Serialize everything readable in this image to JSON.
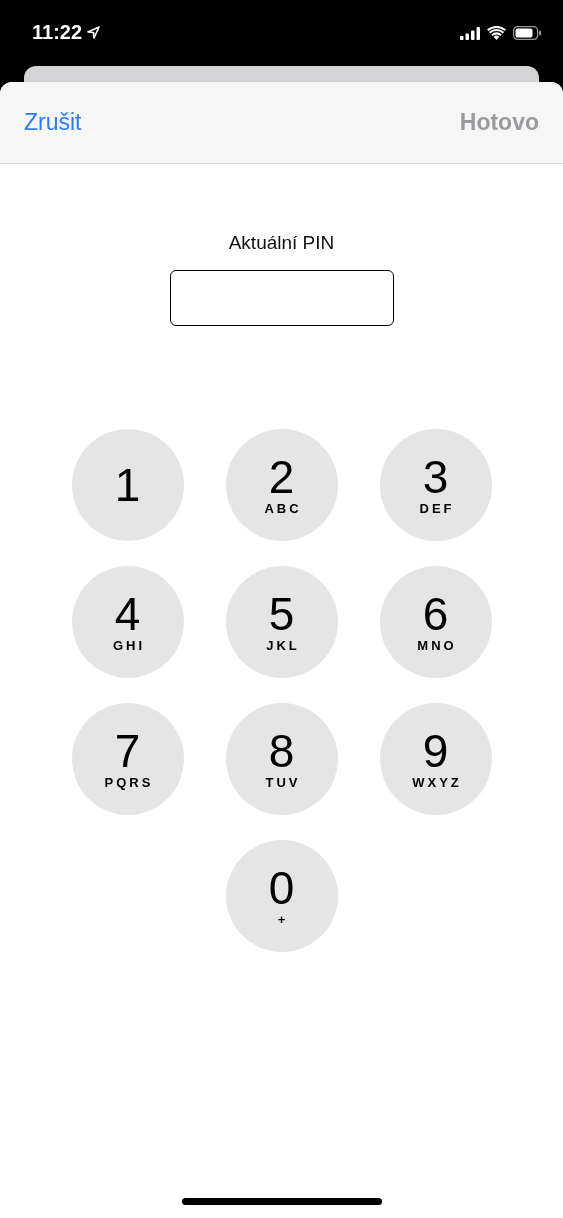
{
  "status_bar": {
    "time": "11:22"
  },
  "nav": {
    "cancel": "Zrušit",
    "done": {
      "label": "Hotovo",
      "disabled": true
    }
  },
  "pin": {
    "label": "Aktuální PIN"
  },
  "keys": [
    {
      "digit": "1"
    },
    {
      "digit": "2",
      "letters": "ABC"
    },
    {
      "digit": "3",
      "letters": "DEF"
    },
    {
      "digit": "4",
      "letters": "GHI"
    },
    {
      "digit": "5",
      "letters": "JKL"
    },
    {
      "digit": "6",
      "letters": "MNO"
    },
    {
      "digit": "7",
      "letters": "PQRS"
    },
    {
      "digit": "8",
      "letters": "TUV"
    },
    {
      "digit": "9",
      "letters": "WXYZ"
    },
    {
      "digit": "0",
      "letters": "+"
    }
  ]
}
